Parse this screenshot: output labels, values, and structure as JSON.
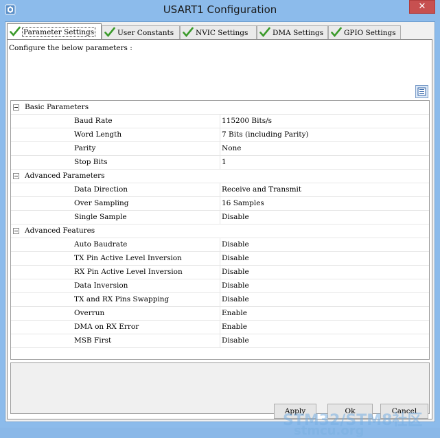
{
  "window": {
    "title": "USART1 Configuration"
  },
  "tabs": [
    {
      "label": "Parameter Settings",
      "active": true
    },
    {
      "label": "User Constants",
      "active": false
    },
    {
      "label": "NVIC Settings",
      "active": false
    },
    {
      "label": "DMA Settings",
      "active": false
    },
    {
      "label": "GPIO Settings",
      "active": false
    }
  ],
  "hint": "Configure the below parameters :",
  "groups": [
    {
      "label": "Basic Parameters",
      "params": [
        {
          "name": "Baud Rate",
          "value": "115200 Bits/s"
        },
        {
          "name": "Word Length",
          "value": "7 Bits (including Parity)"
        },
        {
          "name": "Parity",
          "value": "None"
        },
        {
          "name": "Stop Bits",
          "value": "1"
        }
      ]
    },
    {
      "label": "Advanced Parameters",
      "params": [
        {
          "name": "Data Direction",
          "value": "Receive and Transmit"
        },
        {
          "name": "Over Sampling",
          "value": "16 Samples"
        },
        {
          "name": "Single Sample",
          "value": "Disable"
        }
      ]
    },
    {
      "label": "Advanced Features",
      "params": [
        {
          "name": "Auto Baudrate",
          "value": "Disable"
        },
        {
          "name": "TX Pin Active Level Inversion",
          "value": "Disable"
        },
        {
          "name": "RX Pin Active Level Inversion",
          "value": "Disable"
        },
        {
          "name": "Data Inversion",
          "value": "Disable"
        },
        {
          "name": "TX and RX Pins Swapping",
          "value": "Disable"
        },
        {
          "name": "Overrun",
          "value": "Enable"
        },
        {
          "name": "DMA on RX Error",
          "value": "Enable"
        },
        {
          "name": "MSB First",
          "value": "Disable"
        }
      ]
    }
  ],
  "buttons": {
    "apply": "Apply",
    "ok": "Ok",
    "cancel": "Cancel"
  },
  "watermark": {
    "line1": "STM32/STM8社区",
    "line2": "stmcu.org"
  },
  "colors": {
    "titlebar": "#8cbbeb",
    "close": "#c75050",
    "check": "#3a9a2a"
  }
}
